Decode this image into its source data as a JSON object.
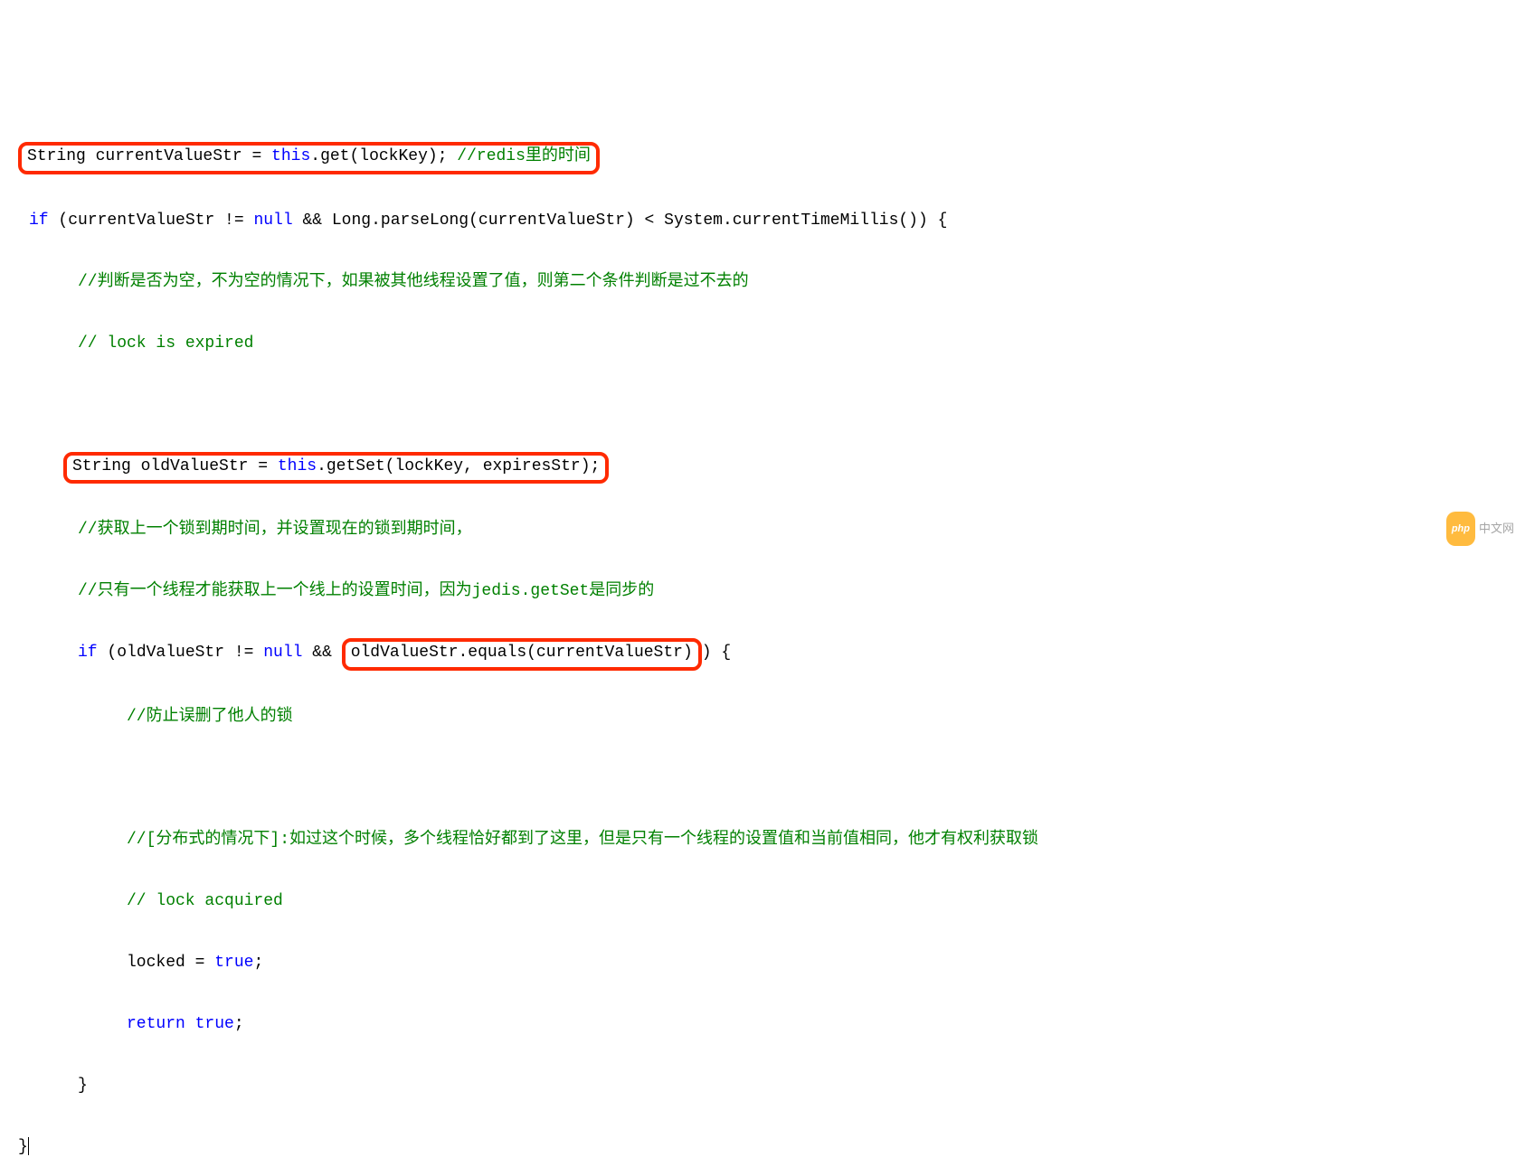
{
  "code": {
    "l1_a": "String currentValueStr = ",
    "l1_b": "this",
    "l1_c": ".get(lockKey); ",
    "l1_d": "//redis里的时间",
    "l2_a": "if",
    "l2_b": " (currentValueStr != ",
    "l2_c": "null",
    "l2_d": " && Long.parseLong(currentValueStr) < System.currentTimeMillis()) {",
    "l3": "//判断是否为空，不为空的情况下，如果被其他线程设置了值，则第二个条件判断是过不去的",
    "l4": "// lock is expired",
    "l5_a": "String oldValueStr = ",
    "l5_b": "this",
    "l5_c": ".getSet(lockKey, expiresStr);",
    "l6": "//获取上一个锁到期时间，并设置现在的锁到期时间，",
    "l7": "//只有一个线程才能获取上一个线上的设置时间，因为jedis.getSet是同步的",
    "l8_a": "if",
    "l8_b": " (oldValueStr != ",
    "l8_c": "null",
    "l8_d": " && ",
    "l8_e": "oldValueStr.equals(currentValueStr)",
    "l8_f": ") {",
    "l9": "//防止误删了他人的锁",
    "l10": "//[分布式的情况下]:如过这个时候，多个线程恰好都到了这里，但是只有一个线程的设置值和当前值相同，他才有权利获取锁",
    "l11": "// lock acquired",
    "l12_a": "locked = ",
    "l12_b": "true",
    "l12_c": ";",
    "l13_a": "return",
    "l13_b": " ",
    "l13_c": "true",
    "l13_d": ";",
    "l14": "}",
    "l15": "}"
  },
  "watermark": {
    "badge": "php",
    "text": "中文网"
  }
}
